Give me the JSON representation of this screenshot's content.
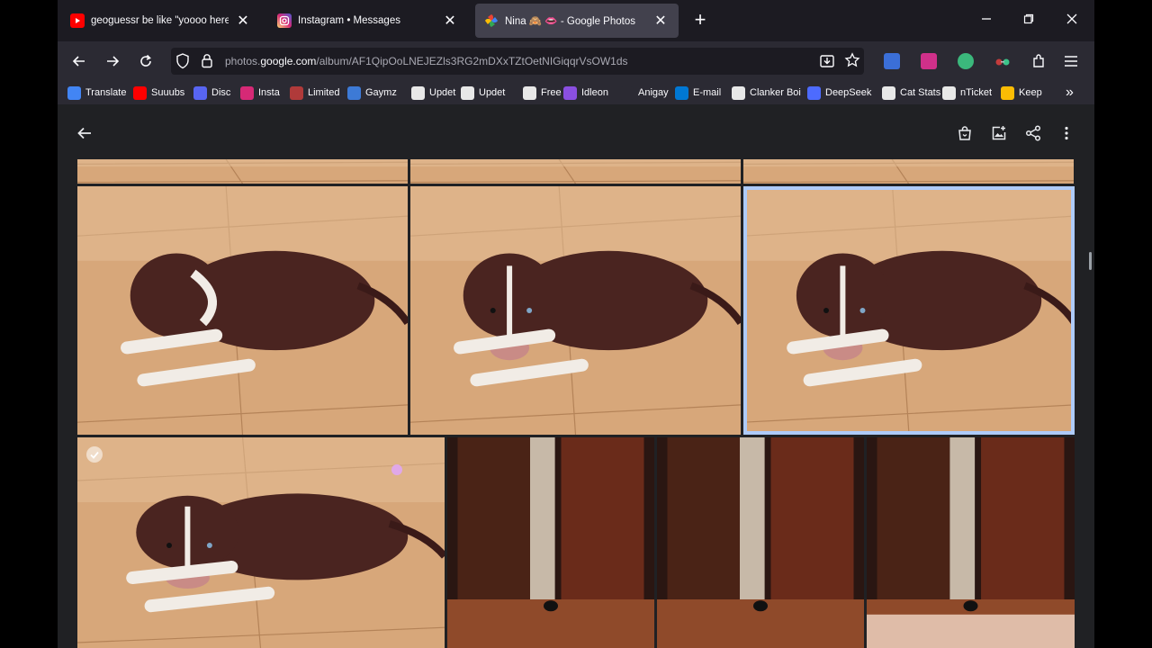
{
  "tabs": [
    {
      "title": "geoguessr be like \"yoooo here's the n",
      "icon": "youtube-icon",
      "active": false
    },
    {
      "title": "Instagram • Messages",
      "icon": "instagram-icon",
      "active": false
    },
    {
      "title": "Nina 🙈 👄 - Google Photos",
      "icon": "google-photos-icon",
      "active": true
    }
  ],
  "url": {
    "pre": "photos.",
    "domain": "google.com",
    "post": "/album/AF1QipOoLNEJEZls3RG2mDXxTZtOetNIGiqqrVsOW1ds"
  },
  "bookmarks": [
    {
      "label": "Translate",
      "color": "#4285f4"
    },
    {
      "label": "Suuubs",
      "color": "#ff0000"
    },
    {
      "label": "Disc",
      "color": "#5865f2"
    },
    {
      "label": "Insta",
      "color": "#d62976"
    },
    {
      "label": "Limited",
      "color": "#b03a3a"
    },
    {
      "label": "Gaymz",
      "color": "#3d7ad6"
    },
    {
      "label": "Updet",
      "color": "#e8e8e8"
    },
    {
      "label": "Updet",
      "color": "#e8e8e8"
    },
    {
      "label": "Free",
      "color": "#e8e8e8"
    },
    {
      "label": "Idleon",
      "color": "#8a4fe0"
    },
    {
      "label": "Anigay",
      "color": "#2b2a33"
    },
    {
      "label": "E-mail",
      "color": "#0078d4"
    },
    {
      "label": "Clanker Boi",
      "color": "#e8e8e8"
    },
    {
      "label": "DeepSeek",
      "color": "#4d6bfe"
    },
    {
      "label": "Cat Stats",
      "color": "#e8e8e8"
    },
    {
      "label": "nTicket",
      "color": "#e8e8e8"
    },
    {
      "label": "Keep",
      "color": "#fbbc04"
    }
  ],
  "colors": {
    "selection": "#aecbfa",
    "page_bg": "#202124",
    "chrome_bg": "#2b2a33"
  }
}
